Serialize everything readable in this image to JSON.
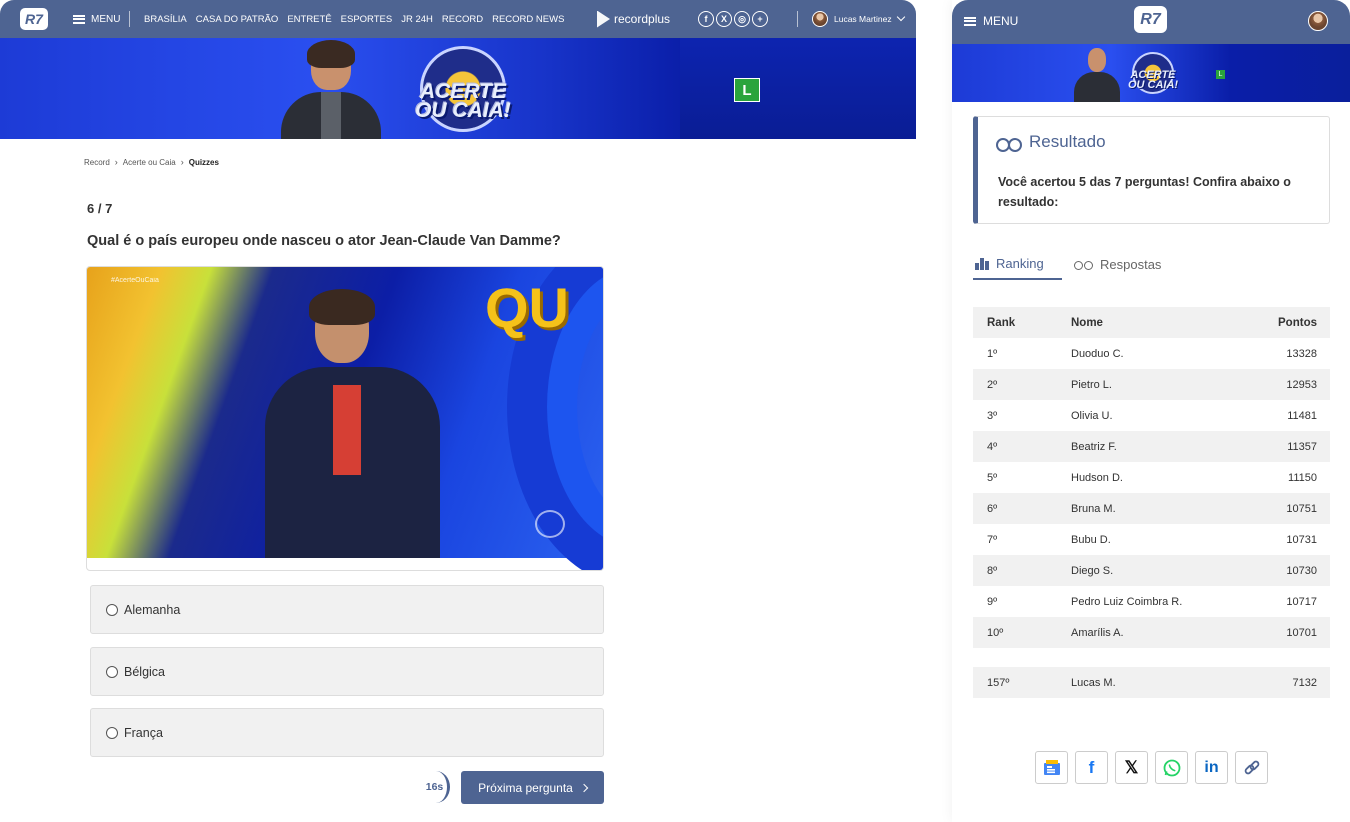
{
  "desktop": {
    "nav": {
      "logo": "R7",
      "menu_label": "MENU",
      "links": [
        "BRASÍLIA",
        "CASA DO PATRÃO",
        "ENTRETÊ",
        "ESPORTES",
        "JR 24H",
        "RECORD",
        "RECORD NEWS"
      ],
      "recordplus": "recordplus",
      "socials": [
        "facebook-icon",
        "x-icon",
        "instagram-icon",
        "plus-icon"
      ],
      "user_name": "Lucas Martinez"
    },
    "banner": {
      "show_title_line1": "ACERTE",
      "show_title_line2": "OU CAIA!",
      "rating": "L"
    },
    "breadcrumb": [
      "Record",
      "Acerte ou Caia",
      "Quizzes"
    ],
    "quiz": {
      "counter": "6 / 7",
      "question": "Qual é o país europeu onde nasceu o ator Jean-Claude Van Damme?",
      "image_tag": "#AcerteOuCaia",
      "image_text": "QU",
      "options": [
        "Alemanha",
        "Bélgica",
        "França"
      ],
      "timer": "16s",
      "next_label": "Próxima pergunta"
    }
  },
  "mobile": {
    "menu_label": "MENU",
    "logo": "R7",
    "banner": {
      "line1": "ACERTE",
      "line2": "OU CAIA!",
      "rating": "L"
    },
    "result": {
      "title": "Resultado",
      "message": "Você acertou 5 das 7 perguntas! Confira abaixo o resultado:"
    },
    "tabs": [
      {
        "label": "Ranking",
        "icon": "podium-icon",
        "active": true
      },
      {
        "label": "Respostas",
        "icon": "glasses-icon",
        "active": false
      }
    ],
    "ranking": {
      "headers": [
        "Rank",
        "Nome",
        "Pontos"
      ],
      "rows": [
        {
          "rank": "1º",
          "name": "Duoduo C.",
          "points": "13328"
        },
        {
          "rank": "2º",
          "name": "Pietro L.",
          "points": "12953"
        },
        {
          "rank": "3º",
          "name": "Olivia U.",
          "points": "11481"
        },
        {
          "rank": "4º",
          "name": "Beatriz F.",
          "points": "11357"
        },
        {
          "rank": "5º",
          "name": "Hudson D.",
          "points": "11150"
        },
        {
          "rank": "6º",
          "name": "Bruna M.",
          "points": "10751"
        },
        {
          "rank": "7º",
          "name": "Bubu D.",
          "points": "10731"
        },
        {
          "rank": "8º",
          "name": "Diego S.",
          "points": "10730"
        },
        {
          "rank": "9º",
          "name": "Pedro Luiz Coimbra R.",
          "points": "10717"
        },
        {
          "rank": "10º",
          "name": "Amarílis A.",
          "points": "10701"
        }
      ],
      "me": {
        "rank": "157º",
        "name": "Lucas M.",
        "points": "7132"
      }
    },
    "share": [
      {
        "icon": "google-news-icon",
        "color": "#4285f4"
      },
      {
        "icon": "facebook-icon",
        "color": "#1877f2"
      },
      {
        "icon": "x-icon",
        "color": "#111111"
      },
      {
        "icon": "whatsapp-icon",
        "color": "#25d366"
      },
      {
        "icon": "linkedin-icon",
        "color": "#0a66c2"
      },
      {
        "icon": "link-icon",
        "color": "#4e6492"
      }
    ]
  },
  "colors": {
    "brand": "#4e6492",
    "rating_green": "#2aa43c",
    "row_alt": "#f1f1f1"
  }
}
